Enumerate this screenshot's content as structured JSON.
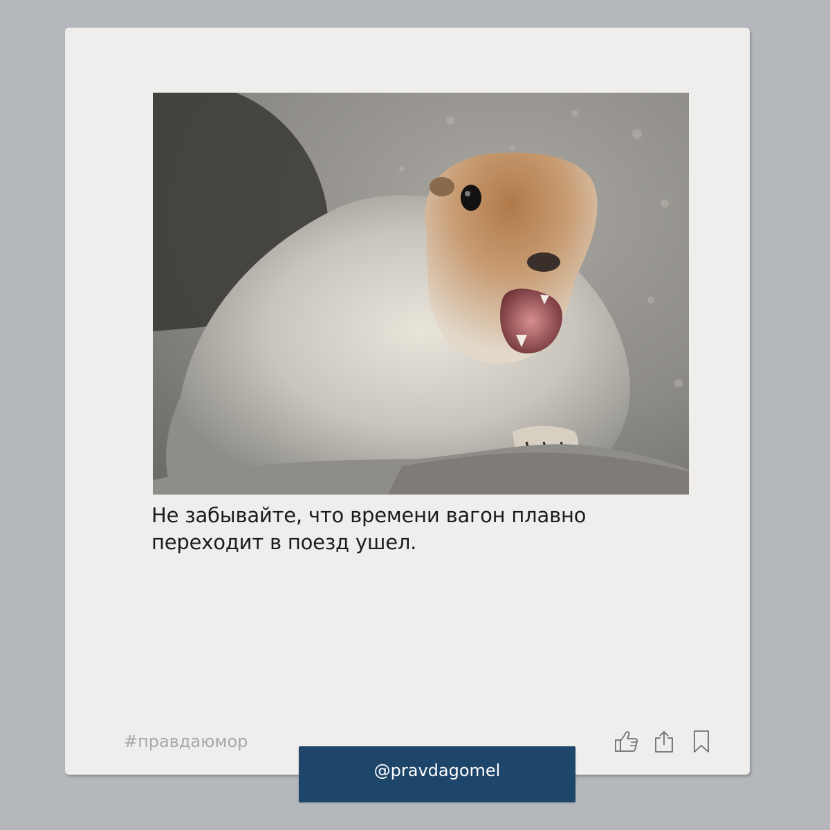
{
  "post": {
    "image_alt": "Arctic ground squirrel with open mouth on a rock",
    "caption_line1": "Не забывайте, что времени вагон плавно",
    "caption_line2": "переходит в поезд ушел.",
    "hashtag": "#правдаюмор",
    "actions": {
      "like_icon": "thumbs-up-icon",
      "share_icon": "share-icon",
      "bookmark_icon": "bookmark-icon"
    }
  },
  "footer": {
    "handle": "@pravdagomel"
  },
  "colors": {
    "page_background": "#b4b8bd",
    "card_background": "#efeeec",
    "handle_bar": "#1e456a",
    "hashtag": "#a8a8a8",
    "icon_stroke": "#6e6e6e"
  }
}
